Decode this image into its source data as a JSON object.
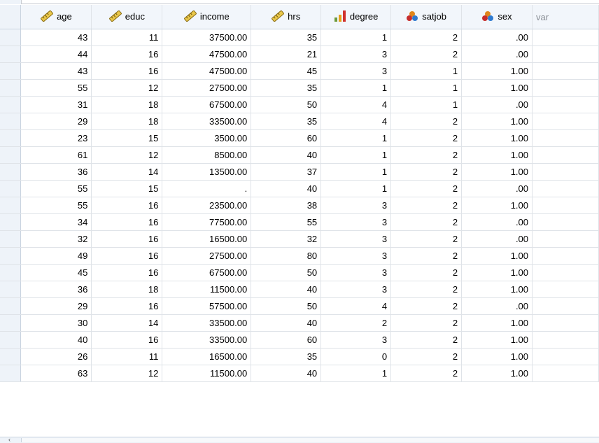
{
  "columns": [
    {
      "label": "age",
      "icon": "ruler-scale-icon"
    },
    {
      "label": "educ",
      "icon": "ruler-scale-icon"
    },
    {
      "label": "income",
      "icon": "ruler-scale-icon"
    },
    {
      "label": "hrs",
      "icon": "ruler-scale-icon"
    },
    {
      "label": "degree",
      "icon": "bar-ordinal-icon"
    },
    {
      "label": "satjob",
      "icon": "nominal-balls-icon"
    },
    {
      "label": "sex",
      "icon": "nominal-balls-icon"
    }
  ],
  "empty_column_label": "var",
  "rows": [
    [
      "43",
      "11",
      "37500.00",
      "35",
      "1",
      "2",
      ".00"
    ],
    [
      "44",
      "16",
      "47500.00",
      "21",
      "3",
      "2",
      ".00"
    ],
    [
      "43",
      "16",
      "47500.00",
      "45",
      "3",
      "1",
      "1.00"
    ],
    [
      "55",
      "12",
      "27500.00",
      "35",
      "1",
      "1",
      "1.00"
    ],
    [
      "31",
      "18",
      "67500.00",
      "50",
      "4",
      "1",
      ".00"
    ],
    [
      "29",
      "18",
      "33500.00",
      "35",
      "4",
      "2",
      "1.00"
    ],
    [
      "23",
      "15",
      "3500.00",
      "60",
      "1",
      "2",
      "1.00"
    ],
    [
      "61",
      "12",
      "8500.00",
      "40",
      "1",
      "2",
      "1.00"
    ],
    [
      "36",
      "14",
      "13500.00",
      "37",
      "1",
      "2",
      "1.00"
    ],
    [
      "55",
      "15",
      ".",
      "40",
      "1",
      "2",
      ".00"
    ],
    [
      "55",
      "16",
      "23500.00",
      "38",
      "3",
      "2",
      "1.00"
    ],
    [
      "34",
      "16",
      "77500.00",
      "55",
      "3",
      "2",
      ".00"
    ],
    [
      "32",
      "16",
      "16500.00",
      "32",
      "3",
      "2",
      ".00"
    ],
    [
      "49",
      "16",
      "27500.00",
      "80",
      "3",
      "2",
      "1.00"
    ],
    [
      "45",
      "16",
      "67500.00",
      "50",
      "3",
      "2",
      "1.00"
    ],
    [
      "36",
      "18",
      "11500.00",
      "40",
      "3",
      "2",
      "1.00"
    ],
    [
      "29",
      "16",
      "57500.00",
      "50",
      "4",
      "2",
      ".00"
    ],
    [
      "30",
      "14",
      "33500.00",
      "40",
      "2",
      "2",
      "1.00"
    ],
    [
      "40",
      "16",
      "33500.00",
      "60",
      "3",
      "2",
      "1.00"
    ],
    [
      "26",
      "11",
      "16500.00",
      "35",
      "0",
      "2",
      "1.00"
    ],
    [
      "63",
      "12",
      "11500.00",
      "40",
      "1",
      "2",
      "1.00"
    ]
  ]
}
